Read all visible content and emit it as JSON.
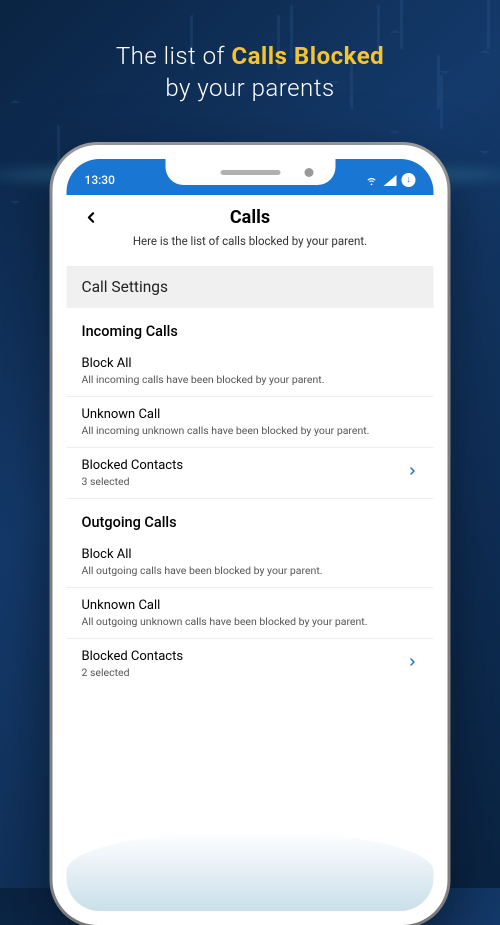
{
  "promo": {
    "line1_pre": "The list of ",
    "line1_highlight": "Calls Blocked",
    "line2": "by your parents"
  },
  "statusbar": {
    "time": "13:30"
  },
  "header": {
    "title": "Calls",
    "subtitle": "Here is the list of calls blocked by your parent."
  },
  "section": {
    "title": "Call Settings"
  },
  "incoming": {
    "heading": "Incoming Calls",
    "block_all": {
      "title": "Block All",
      "desc": "All incoming calls have been blocked by your parent."
    },
    "unknown": {
      "title": "Unknown Call",
      "desc": "All incoming unknown calls have been blocked by your parent."
    },
    "blocked_contacts": {
      "title": "Blocked Contacts",
      "desc": "3 selected"
    }
  },
  "outgoing": {
    "heading": "Outgoing Calls",
    "block_all": {
      "title": "Block All",
      "desc": "All outgoing calls have been blocked by your parent."
    },
    "unknown": {
      "title": "Unknown Call",
      "desc": "All outgoing unknown calls have been blocked by your parent."
    },
    "blocked_contacts": {
      "title": "Blocked Contacts",
      "desc": "2 selected"
    }
  }
}
